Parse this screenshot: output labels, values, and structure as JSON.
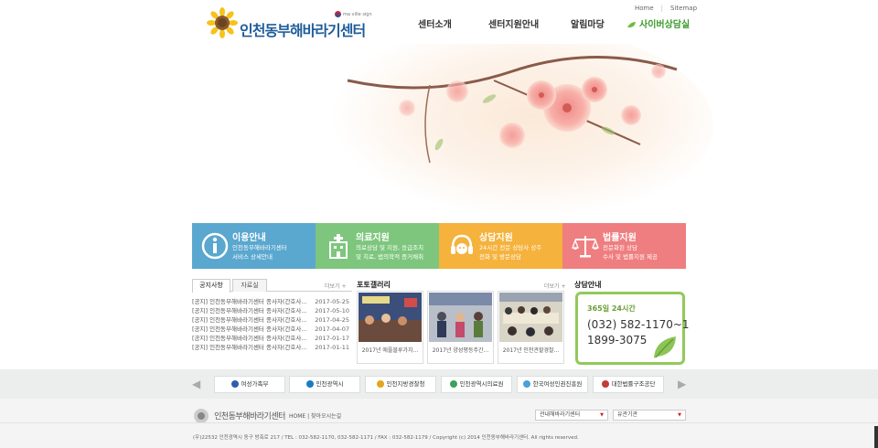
{
  "header": {
    "logo_text": "인천동부해바라기센터",
    "logo_sub": "ma ville sign",
    "util_links": [
      "Home",
      "Sitemap"
    ],
    "nav": [
      "센터소개",
      "센터지원안내",
      "알림마당",
      "사이버상담실"
    ]
  },
  "cards": [
    {
      "title": "이용안내",
      "desc": [
        "인천동부해바라기센터",
        "서비스 상세안내"
      ],
      "icon": "info-icon"
    },
    {
      "title": "의료지원",
      "desc": [
        "의료상담 및 지원, 응급조치",
        "및 치료, 법의학적 증거채취"
      ],
      "icon": "hospital-icon"
    },
    {
      "title": "상담지원",
      "desc": [
        "24시간 전문 상담사 상주",
        "전화 및 방문상담"
      ],
      "icon": "counselor-icon"
    },
    {
      "title": "법률지원",
      "desc": [
        "전문화된 상담",
        "수사 및 법률지원 제공"
      ],
      "icon": "scales-icon"
    }
  ],
  "notice": {
    "tabs": [
      "공지사항",
      "자료실"
    ],
    "more": "더보기 +",
    "items": [
      {
        "title": "[공지] 인천동부해바라기센터 종사자(간호사...",
        "date": "2017-05-25"
      },
      {
        "title": "[공지] 인천동부해바라기센터 종사자(간호사...",
        "date": "2017-05-10"
      },
      {
        "title": "[공지] 인천동부해바라기센터 종사자(간호사...",
        "date": "2017-04-25"
      },
      {
        "title": "[공지] 인천동부해바라기센터 종사자(간호사...",
        "date": "2017-04-07"
      },
      {
        "title": "[공지] 인천동부해바라기센터 종사자(간호사...",
        "date": "2017-01-17"
      },
      {
        "title": "[공지] 인천동부해바라기센터 종사자(간호사...",
        "date": "2017-01-11"
      }
    ]
  },
  "gallery": {
    "title": "포토갤러리",
    "more": "더보기 +",
    "items": [
      {
        "caption": "2017년 애플블루가치..."
      },
      {
        "caption": "2017년 양성평등주간..."
      },
      {
        "caption": "2017년 인천관할경찰..."
      }
    ]
  },
  "consult": {
    "title": "상담안내",
    "hours": "365일 24시간",
    "phone1": "(032) 582-1170~1",
    "phone2": "1899-3075"
  },
  "partners": {
    "prev": "◀",
    "next": "▶",
    "items": [
      "여성가족부",
      "인천광역시",
      "인천지방경찰청",
      "인천광역시의료원",
      "한국여성인권진흥원",
      "대한법률구조공단"
    ]
  },
  "footer": {
    "logo_text": "인천동부해바라기센터",
    "links": "HOME | 찾아오시는길",
    "select1": "관내해바라기센터",
    "select2": "유관기관",
    "copyright": "(우)22532 인천광역시 동구 방축로 217 / TEL : 032-582-1170, 032-582-1171 / FAX : 032-582-1179 / Copyright (c) 2014 인천동부해바라기센터. All rights reserved."
  },
  "colors": {
    "card1": "#5aa7cf",
    "card2": "#7ec67e",
    "card3": "#f5b23c",
    "card4": "#ef7e80",
    "brand": "#1f5d9b",
    "green": "#3c9a2c"
  }
}
